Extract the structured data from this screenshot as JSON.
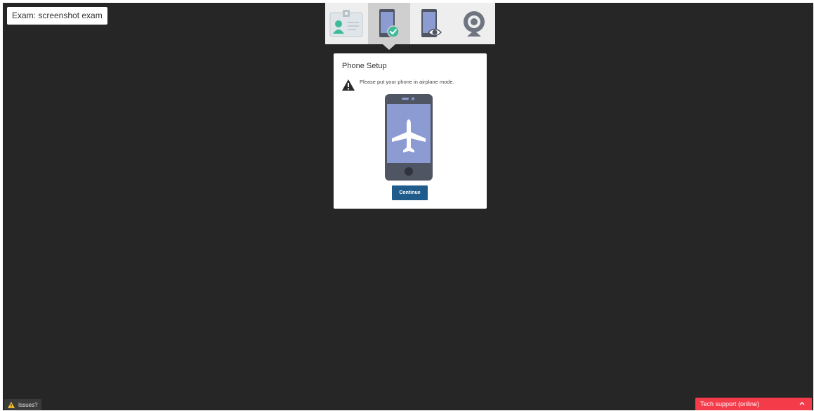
{
  "exam": {
    "label": "Exam: screenshot exam"
  },
  "steps": [
    {
      "name": "id-card-icon",
      "state": "pending"
    },
    {
      "name": "phone-check-icon",
      "state": "active"
    },
    {
      "name": "phone-eye-icon",
      "state": "pending"
    },
    {
      "name": "webcam-icon",
      "state": "pending"
    }
  ],
  "panel": {
    "title": "Phone Setup",
    "message": "Please put your phone in airplane mode.",
    "illustration_icon": "phone-airplane-icon",
    "continue_label": "Continue"
  },
  "footer": {
    "issues_label": "Issues?",
    "tech_support_label": "Tech support (online)"
  },
  "colors": {
    "background": "#262626",
    "accent_blue": "#1f5c8c",
    "tech_support_red": "#f43b4a",
    "check_green": "#3dbb9a",
    "phone_screen": "#8c9bd1",
    "phone_body": "#4f5563"
  }
}
